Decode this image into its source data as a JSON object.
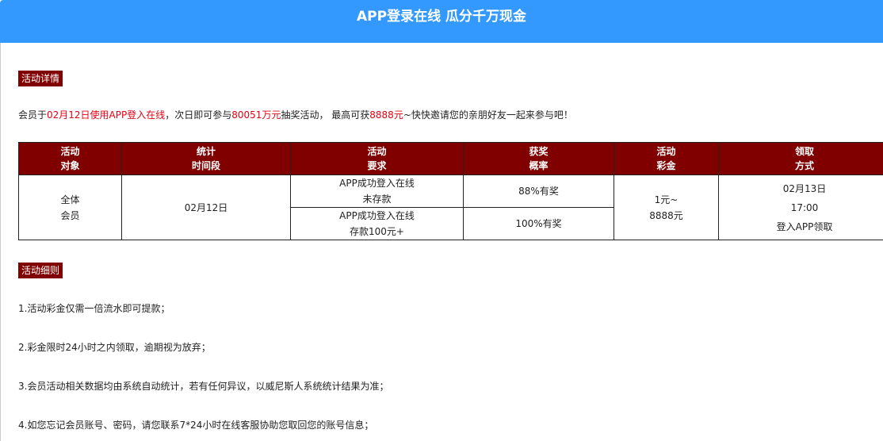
{
  "header": {
    "title": "APP登录在线 瓜分千万现金"
  },
  "sections": {
    "details_tag": "活动详情",
    "rules_tag": "活动细则"
  },
  "intro": {
    "p1": "会员于",
    "p2": "02月12日使用APP登入在线",
    "p3": "，次日即可参与",
    "p4": "80051万元",
    "p5": "抽奖活动， 最高可获",
    "p6": "8888元",
    "p7": "~快快邀请您的亲朋好友一起来参与吧！"
  },
  "table": {
    "headers": [
      {
        "l1": "活动",
        "l2": "对象"
      },
      {
        "l1": "统计",
        "l2": "时间段"
      },
      {
        "l1": "活动",
        "l2": "要求"
      },
      {
        "l1": "获奖",
        "l2": "概率"
      },
      {
        "l1": "活动",
        "l2": "彩金"
      },
      {
        "l1": "领取",
        "l2": "方式"
      }
    ],
    "target": {
      "l1": "全体",
      "l2": "会员"
    },
    "period": "02月12日",
    "req1": {
      "l1": "APP成功登入在线",
      "l2": "未存款"
    },
    "req2": {
      "l1": "APP成功登入在线",
      "l2": "存款100元+"
    },
    "prob1": "88%有奖",
    "prob2": "100%有奖",
    "bonus": {
      "l1": "1元~",
      "l2": "8888元"
    },
    "claim": {
      "l1": "02月13日",
      "l2": "17:00",
      "l3": "登入APP领取"
    }
  },
  "rules": [
    "1.活动彩金仅需一倍流水即可提款；",
    "2.彩金限时24小时之内领取，逾期视为放弃；",
    "3.会员活动相关数据均由系统自动统计，若有任何异议，以威尼斯人系统统计结果为准；",
    "4.如您忘记会员账号、密码，请您联系7*24小时在线客服协助您取回您的账号信息；"
  ]
}
